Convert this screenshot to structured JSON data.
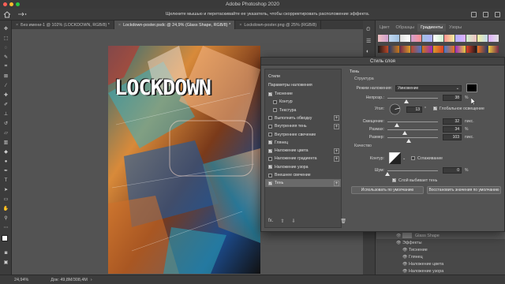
{
  "app": {
    "title": "Adobe Photoshop 2020"
  },
  "options_hint": "Щелкните мышью и перетаскивайте ее указатель, чтобы скорректировать расположение эффекта.",
  "doc_tabs": [
    {
      "label": "Без имени-1 @ 102% (LOCKDOWN, RGB/8) *",
      "active": false
    },
    {
      "label": "Lockdown-poster.psdc @ 24,9% (Glass Shape, RGB/8) *",
      "active": true
    },
    {
      "label": "Lockdown-poster.png @ 25% (RGB/8)",
      "active": false
    }
  ],
  "poster": {
    "title": "LOCKDOWN"
  },
  "panel_tabs": [
    "Цвет",
    "Образцы",
    "Градиенты",
    "Узоры"
  ],
  "panel_active_tab": "Градиенты",
  "gradient_swatches": [
    [
      "#f0c0c0",
      "#c0d8f0",
      "#e0e0e0",
      "#d0a0d0",
      "#a0c0e0",
      "#ffffff",
      "#ff9090",
      "#b0b0ff",
      "#d0f0d0",
      "#f0f0a0",
      "#e0b0ff"
    ],
    [
      "#1a1a1a",
      "#2a3a6a",
      "#7a2a4a",
      "#c04a2a",
      "#d07a1a",
      "#e0a02a",
      "#4a7ad0",
      "#a02ac0",
      "#e0402a",
      "#f07020",
      "#f0d040"
    ]
  ],
  "dialog": {
    "title": "Стиль слоя",
    "styles_header": "Стили",
    "blend_options": "Параметры наложения",
    "styles": [
      {
        "label": "Тиснение",
        "checked": true,
        "plus": false,
        "indent": false
      },
      {
        "label": "Контур",
        "checked": false,
        "plus": false,
        "indent": true
      },
      {
        "label": "Текстура",
        "checked": false,
        "plus": false,
        "indent": true
      },
      {
        "label": "Выполнить обводку",
        "checked": false,
        "plus": true,
        "indent": false
      },
      {
        "label": "Внутренняя тень",
        "checked": false,
        "plus": true,
        "indent": false
      },
      {
        "label": "Внутреннее свечение",
        "checked": false,
        "plus": false,
        "indent": false
      },
      {
        "label": "Глянец",
        "checked": true,
        "plus": false,
        "indent": false
      },
      {
        "label": "Наложение цвета",
        "checked": true,
        "plus": true,
        "indent": false
      },
      {
        "label": "Наложение градиента",
        "checked": false,
        "plus": true,
        "indent": false
      },
      {
        "label": "Наложение узора",
        "checked": true,
        "plus": false,
        "indent": false
      },
      {
        "label": "Внешнее свечение",
        "checked": false,
        "plus": false,
        "indent": false
      },
      {
        "label": "Тень",
        "checked": true,
        "plus": true,
        "indent": false,
        "selected": true
      }
    ],
    "fx_label": "fx.",
    "section_title": "Тень",
    "structure_title": "Структура",
    "blend_mode_label": "Режим наложения:",
    "blend_mode_value": "Умножение",
    "shadow_color": "#000000",
    "opacity": {
      "label": "Непрозр.:",
      "value": "38",
      "unit": "%",
      "fraction": 0.38
    },
    "angle": {
      "label": "Угол:",
      "value": "13",
      "unit": "°"
    },
    "global_light_label": "Глобальное освещение",
    "global_light": true,
    "distance": {
      "label": "Смещение:",
      "value": "32",
      "unit": "пикс.",
      "fraction": 0.18
    },
    "spread": {
      "label": "Размах:",
      "value": "34",
      "unit": "%",
      "fraction": 0.34
    },
    "size": {
      "label": "Размер:",
      "value": "103",
      "unit": "пикс.",
      "fraction": 0.42
    },
    "quality_title": "Качество",
    "contour_label": "Контур:",
    "antialias_label": "Сглаживание",
    "noise": {
      "label": "Шум:",
      "value": "0",
      "unit": "%",
      "fraction": 0.0
    },
    "knockout_label": "Слой выбивает тень",
    "default_button": "Использовать по умолчанию",
    "restore_button": "Восстановить значения по умолчанию"
  },
  "layers": [
    {
      "label": "Glass Shape",
      "top": true
    },
    {
      "label": "Эффекты"
    },
    {
      "label": "Тиснение"
    },
    {
      "label": "Глянец"
    },
    {
      "label": "Наложение цвета"
    },
    {
      "label": "Наложение узора"
    }
  ],
  "status": {
    "zoom": "24,94%",
    "doc": "Док: 49,8M/308,4M"
  }
}
